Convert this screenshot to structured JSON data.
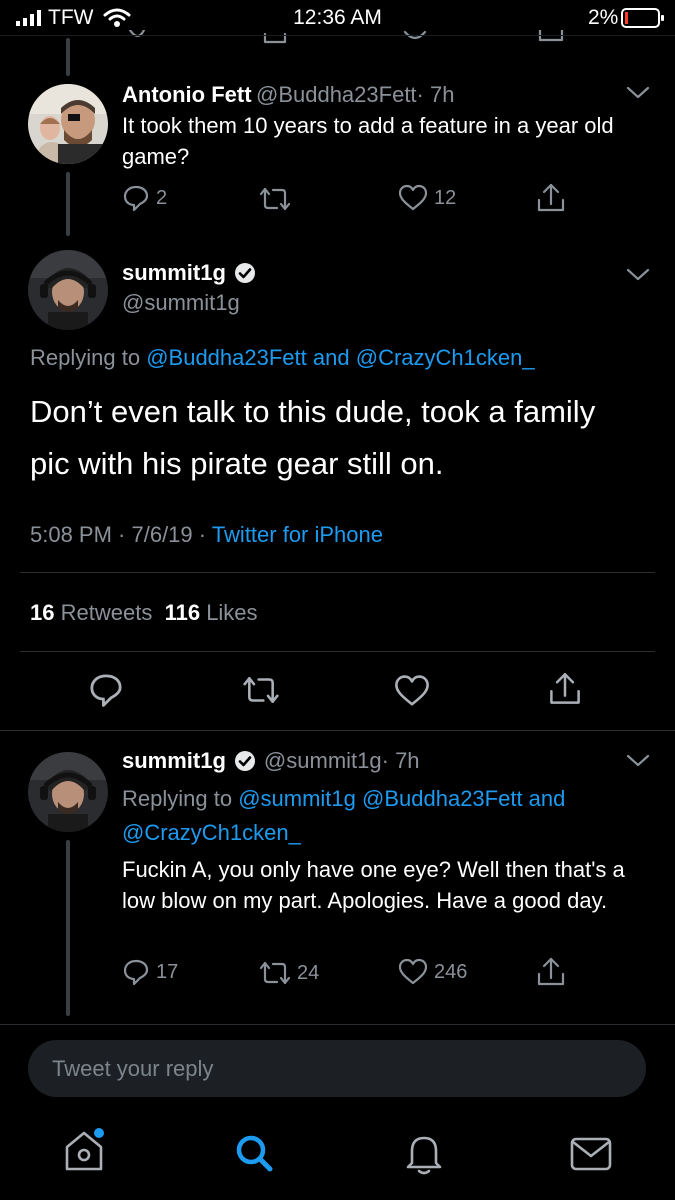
{
  "status_bar": {
    "carrier": "TFW",
    "time": "12:36 AM",
    "battery": "2%"
  },
  "tweets": [
    {
      "name": "Antonio Fett",
      "handle": "@Buddha23Fett",
      "age": "· 7h",
      "text": "It took them 10 years to add a feature in a year old game?",
      "replies": "2",
      "retweets": "",
      "likes": "12"
    },
    {
      "name": "summit1g",
      "handle": "@summit1g",
      "replying_prefix": "Replying to",
      "replying_to_1": "@Buddha23Fett",
      "replying_and": "and",
      "replying_to_2": "@CrazyCh1cken_",
      "text": "Don’t even talk to this dude, took a family pic with his pirate gear still on.",
      "timestamp": "5:08 PM · 7/6/19 ·",
      "source": "Twitter for iPhone",
      "retweet_count": "16",
      "retweet_label": "Retweets",
      "like_count": "116",
      "like_label": "Likes"
    },
    {
      "name": "summit1g",
      "handle": "@summit1g",
      "age": "· 7h",
      "replying_prefix": "Replying to",
      "replying_to": "@summit1g @Buddha23Fett and @CrazyCh1cken_",
      "text": "Fuckin A, you only have one eye? Well then that's a low blow on my part. Apologies. Have a good day.",
      "replies": "17",
      "retweets": "24",
      "likes": "246"
    }
  ],
  "reply_bar": {
    "placeholder": "Tweet your reply"
  },
  "colors": {
    "accent": "#1d9bf0",
    "background": "#000000",
    "muted": "#8a9199"
  },
  "nav": [
    "home-icon",
    "search-icon",
    "notifications-icon",
    "messages-icon"
  ]
}
